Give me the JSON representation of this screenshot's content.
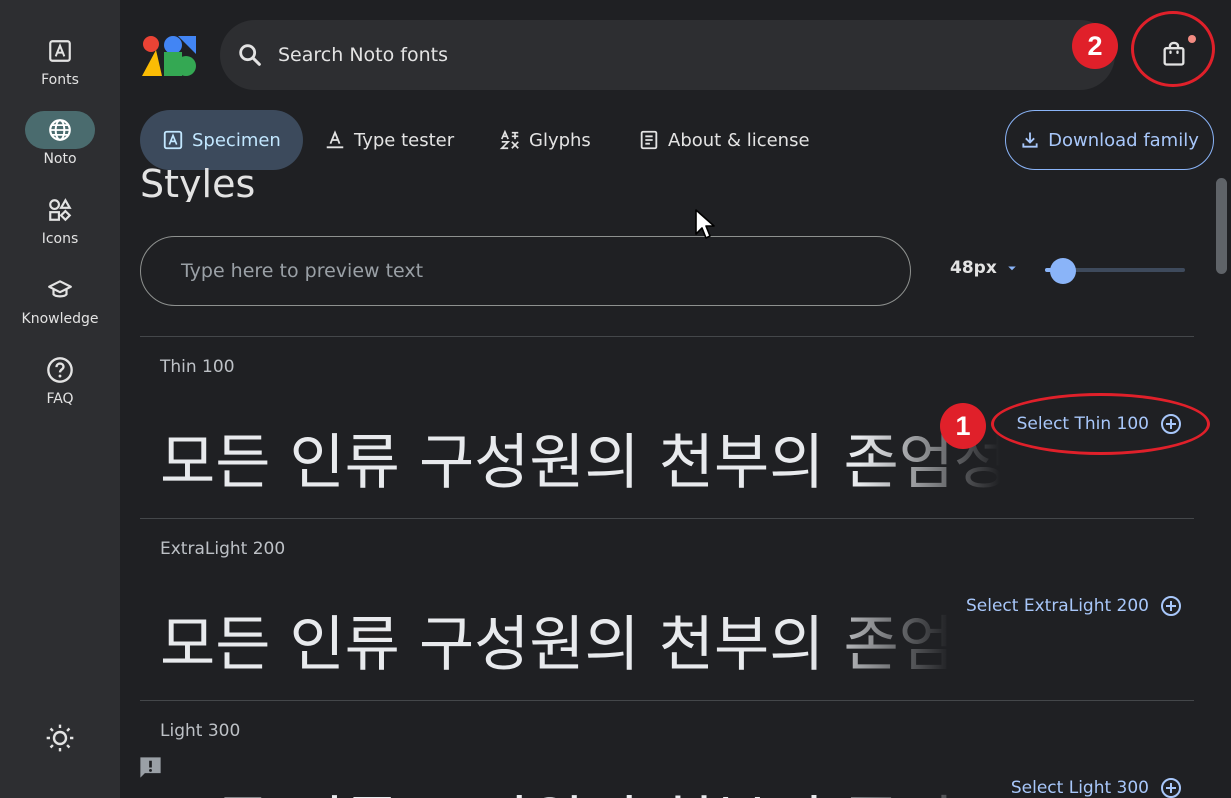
{
  "sidebar": {
    "items": [
      {
        "label": "Fonts",
        "icon": "font-icon"
      },
      {
        "label": "Noto",
        "icon": "globe-icon",
        "active": true
      },
      {
        "label": "Icons",
        "icon": "shapes-icon"
      },
      {
        "label": "Knowledge",
        "icon": "school-icon"
      },
      {
        "label": "FAQ",
        "icon": "help-icon"
      }
    ]
  },
  "search": {
    "placeholder": "Search Noto fonts"
  },
  "tabs": [
    {
      "label": "Specimen",
      "active": true
    },
    {
      "label": "Type tester"
    },
    {
      "label": "Glyphs"
    },
    {
      "label": "About & license"
    }
  ],
  "download_label": "Download family",
  "section_heading": "Styles",
  "preview": {
    "placeholder": "Type here to preview text",
    "size": "48px",
    "slider_fraction": 0.13
  },
  "styles": [
    {
      "name": "Thin 100",
      "select": "Select Thin 100"
    },
    {
      "name": "ExtraLight 200",
      "select": "Select ExtraLight 200"
    },
    {
      "name": "Light 300",
      "select": "Select Light 300"
    }
  ],
  "sample_text": "모든 인류 구성원의 천부의 존엄성과",
  "annotations": [
    "1",
    "2"
  ],
  "colors": {
    "accent": "#8ab4f8",
    "annotation": "#e0202a",
    "background": "#1f2023"
  }
}
